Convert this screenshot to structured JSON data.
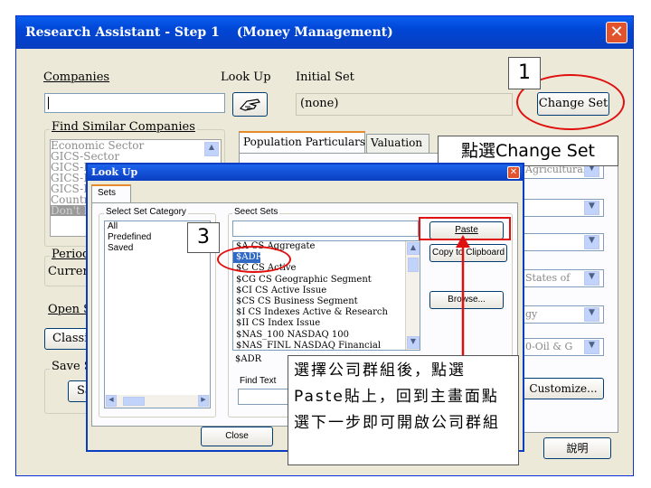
{
  "window": {
    "title": "Research Assistant - Step 1",
    "subtitle": "(Money Management)",
    "close_glyph": "✕"
  },
  "companies": {
    "label": "Companies",
    "value": ""
  },
  "look_up": {
    "label": "Look Up",
    "icon": "hand-pointer-icon"
  },
  "initial_set": {
    "label": "Initial Set",
    "value": "(none)"
  },
  "change_set_button": "Change Set",
  "find_similar": {
    "title": "Find Similar Companies",
    "items": [
      "Economic Sector",
      "GICS-Sector",
      "GICS-I",
      "GICS-I",
      "GICS-I",
      "Countr",
      "Don't H"
    ]
  },
  "period": {
    "title": "Period",
    "value": "Current"
  },
  "open_button": "Open S",
  "classic_button": "Classic",
  "save": {
    "title": "Save S",
    "button": "Sa"
  },
  "tabs": {
    "population": "Population Particulars",
    "valuation": "Valuation"
  },
  "right_combos": [
    "Agricultural",
    "",
    "",
    "States of",
    "gy",
    "0-Oil & G"
  ],
  "customize_button": "Customize...",
  "help_button": "說明",
  "lookup": {
    "title": "Look Up",
    "close_glyph": "✕",
    "tab": "Sets",
    "category_group": "Select Set Category",
    "categories": [
      "All",
      "Predefined",
      "Saved"
    ],
    "sets_group": "Seect Sets",
    "sets_input": "",
    "sets": [
      "$A CS Aggregate",
      "$ADR",
      "$C CS Active",
      "$CG CS Geographic Segment",
      "$CI CS Active Issue",
      "$CS CS Business Segment",
      "$I CS Indexes Active & Research",
      "$II CS Index Issue",
      "$NAS_100 NASDAQ 100",
      "$NAS_FINL NASDAQ Financial"
    ],
    "selected_set": "$ADR",
    "paste_button": "Paste",
    "copy_button": "Copy to Clipboard",
    "browse_button": "Browse...",
    "find_text_label": "Find Text",
    "close_button": "Close"
  },
  "annotations": {
    "step1": "1",
    "step1_caption": "點選Change Set",
    "step3": "3",
    "step3_caption": "選擇公司群組後，點選Paste貼上，回到主畫面點選下一步即可開啟公司群組"
  },
  "colors": {
    "title_bar": "#0046d5",
    "callout_red": "#e01010",
    "selection": "#316ac5"
  }
}
